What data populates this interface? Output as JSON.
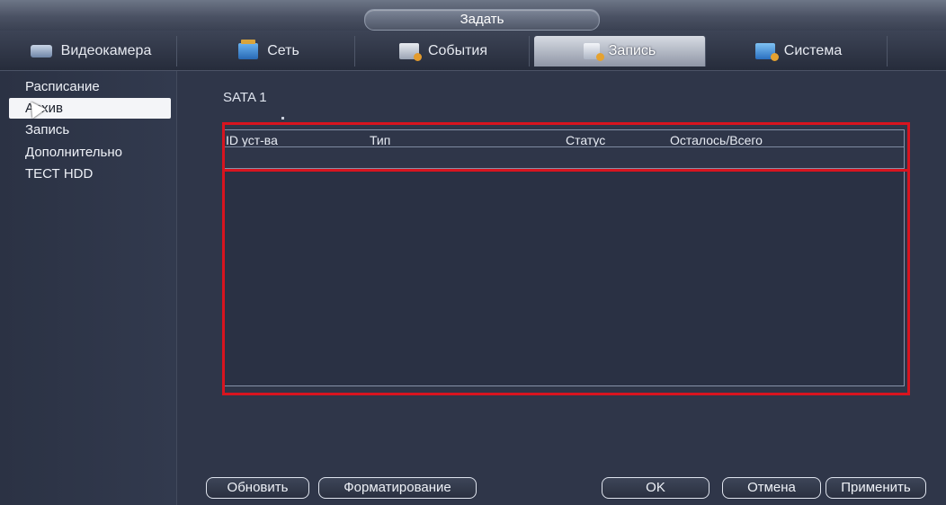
{
  "window": {
    "title": "Задать"
  },
  "tabs": [
    {
      "label": "Видеокамера",
      "icon": "camera-icon"
    },
    {
      "label": "Сеть",
      "icon": "network-icon"
    },
    {
      "label": "События",
      "icon": "events-icon"
    },
    {
      "label": "Запись",
      "icon": "record-icon",
      "active": true
    },
    {
      "label": "Система",
      "icon": "system-icon"
    }
  ],
  "sidebar": {
    "items": [
      {
        "label": "Расписание"
      },
      {
        "label": "Архив",
        "selected": true
      },
      {
        "label": "Запись"
      },
      {
        "label": "Дополнительно"
      },
      {
        "label": "ТЕСТ HDD"
      }
    ]
  },
  "main": {
    "disk_label": "SATA 1",
    "table": {
      "columns": [
        "ID уст-ва",
        "Тип",
        "Статус",
        "Осталось/Всего"
      ],
      "rows": []
    }
  },
  "buttons": {
    "refresh": "Обновить",
    "format": "Форматирование",
    "ok": "OK",
    "cancel": "Отмена",
    "apply": "Применить"
  },
  "colors": {
    "background": "#2f3649",
    "highlight": "#d8141f",
    "active_tab": "#d7dbe3"
  }
}
